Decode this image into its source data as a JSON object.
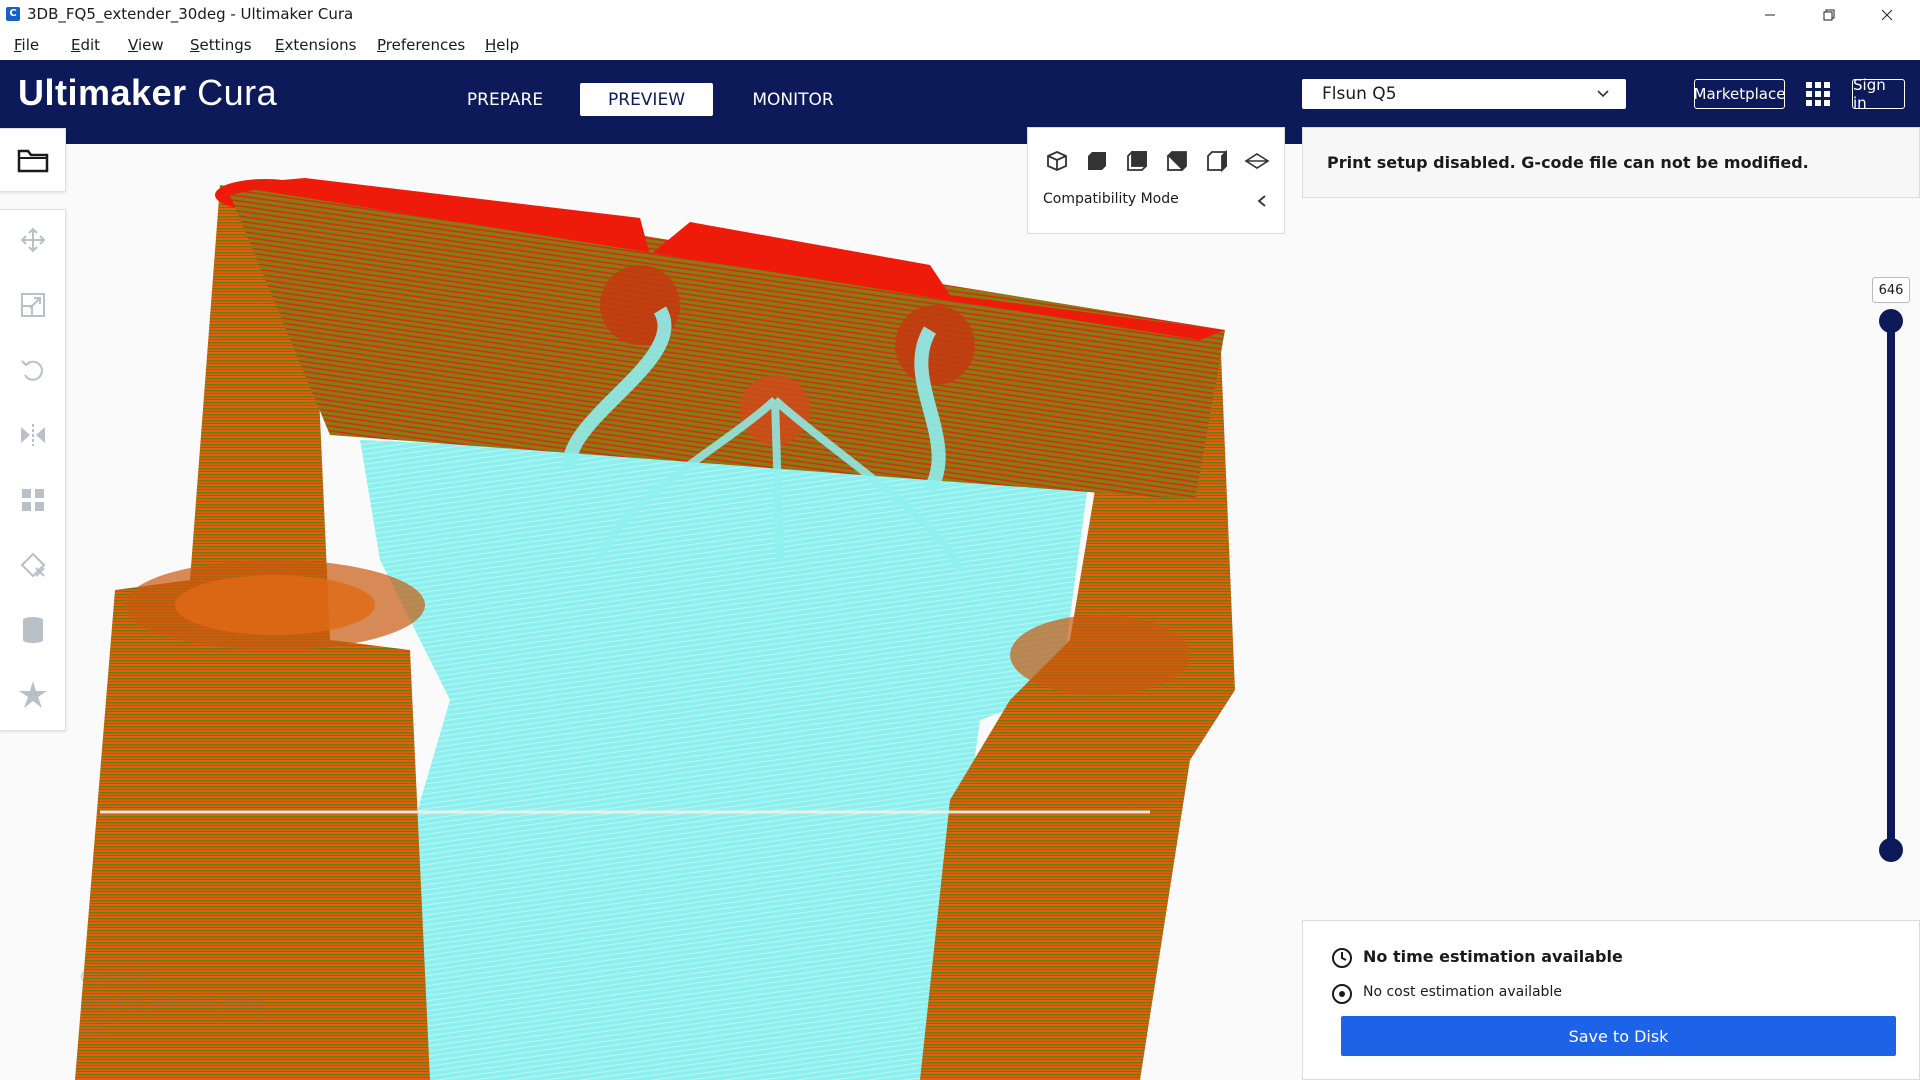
{
  "window": {
    "title": "3DB_FQ5_extender_30deg - Ultimaker Cura",
    "app_icon": "C",
    "controls": [
      "minimize",
      "restore",
      "close"
    ]
  },
  "menu": [
    {
      "label": "File",
      "underline": "F",
      "rest": "ile"
    },
    {
      "label": "Edit",
      "underline": "E",
      "rest": "dit"
    },
    {
      "label": "View",
      "underline": "V",
      "rest": "iew"
    },
    {
      "label": "Settings",
      "underline": "S",
      "rest": "ettings"
    },
    {
      "label": "Extensions",
      "underline": "E",
      "rest": "xtensions"
    },
    {
      "label": "Preferences",
      "underline": "P",
      "rest": "references"
    },
    {
      "label": "Help",
      "underline": "H",
      "rest": "elp"
    }
  ],
  "header": {
    "logo_bold": "Ultimaker",
    "logo_light": "Cura",
    "stages": [
      "PREPARE",
      "PREVIEW",
      "MONITOR"
    ],
    "active_stage": "PREVIEW",
    "printer": "Flsun Q5",
    "marketplace_label": "Marketplace",
    "sign_in_label": "Sign in",
    "colors": {
      "header_bg": "#0c1a5a",
      "accent": "#1d63e8"
    }
  },
  "view_panel": {
    "icons": [
      "3d-view-icon",
      "front-view-icon",
      "top-view-icon",
      "left-view-icon",
      "right-view-icon",
      "x-ray-view-icon"
    ],
    "compatibility_label": "Compatibility Mode"
  },
  "toolbar": {
    "tools": [
      "move-icon",
      "scale-icon",
      "rotate-icon",
      "mirror-icon",
      "per-model-settings-icon",
      "support-blocker-icon",
      "custom-supports-icon",
      "tree-support-icon"
    ]
  },
  "print_setup": {
    "message": "Print setup disabled. G-code file can not be modified."
  },
  "layer_slider": {
    "value": "646"
  },
  "estimate": {
    "time_label": "No time estimation available",
    "cost_label": "No cost estimation available",
    "save_label": "Save to Disk"
  },
  "object_list": {
    "header": "Object list",
    "item": "3DB_FQ5_extender_30deg",
    "dims": "mm"
  }
}
